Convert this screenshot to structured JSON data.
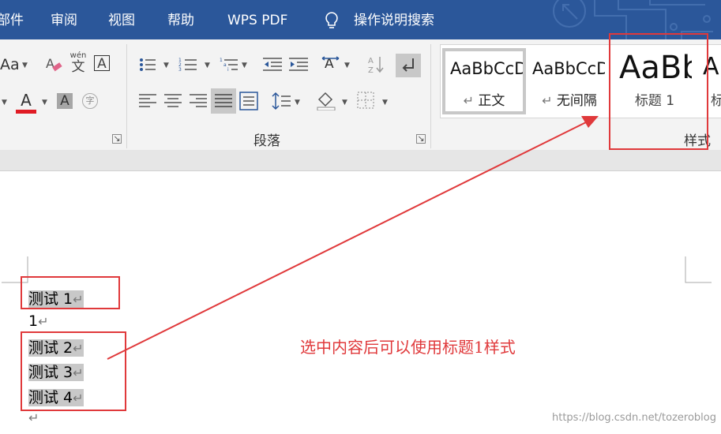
{
  "menu_tabs": [
    "部件",
    "审阅",
    "视图",
    "帮助",
    "WPS PDF"
  ],
  "tell_me": "操作说明搜索",
  "font_group": {
    "size_icon_label": "Aa",
    "phonetic_top": "wén",
    "phonetic_bottom": "文",
    "border_char_label": "A",
    "font_color_label": "A",
    "shading_label": "A",
    "enclose_label": "字"
  },
  "paragraph_group": {
    "label": "段落"
  },
  "styles_group": {
    "label": "样式",
    "items": [
      {
        "sample": "AaBbCcDd",
        "name": "正文",
        "mark": "↵"
      },
      {
        "sample": "AaBbCcDd",
        "name": "无间隔",
        "mark": "↵"
      },
      {
        "sample": "AaBb",
        "name": "标题 1"
      },
      {
        "sample": "A",
        "name": "标"
      }
    ]
  },
  "document": {
    "lines": [
      {
        "text": "测试 1",
        "mark": "↵"
      },
      {
        "text": "1",
        "mark": "↵"
      },
      {
        "text": "测试 2",
        "mark": "↵"
      },
      {
        "text": "测试 3",
        "mark": "↵"
      },
      {
        "text": "测试 4",
        "mark": "↵"
      },
      {
        "text": "",
        "mark": "↵"
      }
    ]
  },
  "annotation": "选中内容后可以使用标题1样式",
  "watermark": "https://blog.csdn.net/tozeroblog",
  "colors": {
    "title_bar": "#2b579a",
    "ribbon": "#f3f3f3",
    "annotation_red": "#e0393b",
    "selection": "#c8c8c8"
  }
}
